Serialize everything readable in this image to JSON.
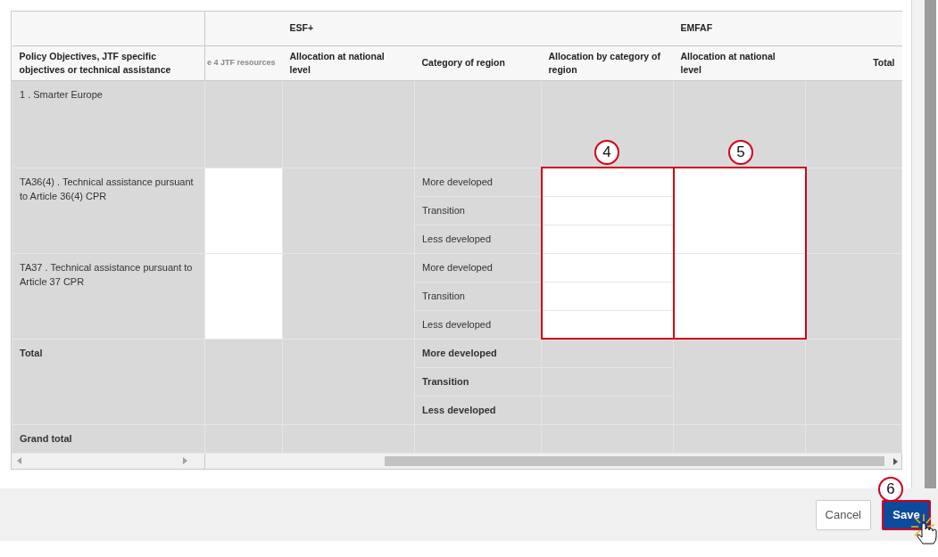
{
  "column_groups": [
    "ESF+",
    "EMFAF"
  ],
  "columns": [
    "Policy Objectives, JTF specific objectives or technical assistance",
    "e 4 JTF resources",
    "Allocation at national level",
    "Category of region",
    "Allocation by category of region",
    "Allocation at national level",
    "Total"
  ],
  "rows": [
    {
      "kind": "objective",
      "label": "1 . Smarter Europe"
    },
    {
      "kind": "assistance",
      "label": "TA36(4) . Technical assistance pursuant to Article 36(4) CPR",
      "categories": [
        "More developed",
        "Transition",
        "Less developed"
      ]
    },
    {
      "kind": "assistance",
      "label": "TA37 . Technical assistance pursuant to Article 37 CPR",
      "categories": [
        "More developed",
        "Transition",
        "Less developed"
      ]
    },
    {
      "kind": "total",
      "label": "Total",
      "categories": [
        "More developed",
        "Transition",
        "Less developed"
      ]
    },
    {
      "kind": "grand_total",
      "label": "Grand total"
    }
  ],
  "callouts": [
    "4",
    "5"
  ],
  "buttons": [
    {
      "label": "Cancel",
      "kind": "secondary"
    },
    {
      "label": "Save",
      "kind": "primary",
      "callout": "6"
    }
  ]
}
